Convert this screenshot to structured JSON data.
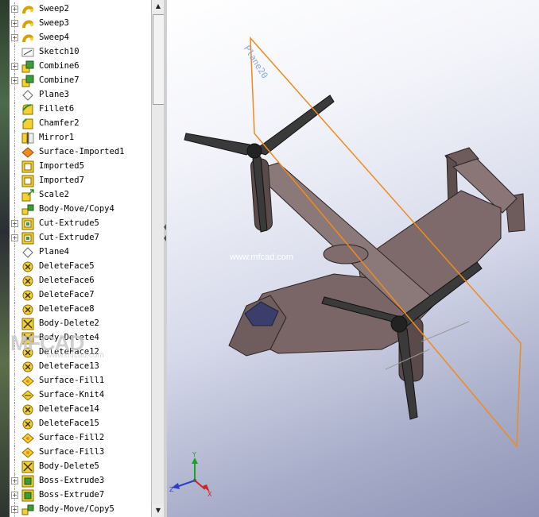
{
  "feature_tree": {
    "items": [
      {
        "label": "Sweep2",
        "icon": "sweep-icon",
        "expandable": true
      },
      {
        "label": "Sweep3",
        "icon": "sweep-icon",
        "expandable": true
      },
      {
        "label": "Sweep4",
        "icon": "sweep-icon",
        "expandable": true
      },
      {
        "label": "Sketch10",
        "icon": "sketch-icon",
        "expandable": false
      },
      {
        "label": "Combine6",
        "icon": "combine-icon",
        "expandable": true
      },
      {
        "label": "Combine7",
        "icon": "combine-icon",
        "expandable": true
      },
      {
        "label": "Plane3",
        "icon": "plane-icon",
        "expandable": false
      },
      {
        "label": "Fillet6",
        "icon": "fillet-icon",
        "expandable": false
      },
      {
        "label": "Chamfer2",
        "icon": "chamfer-icon",
        "expandable": false
      },
      {
        "label": "Mirror1",
        "icon": "mirror-icon",
        "expandable": false
      },
      {
        "label": "Surface-Imported1",
        "icon": "surface-imported-icon",
        "expandable": false
      },
      {
        "label": "Imported5",
        "icon": "imported-icon",
        "expandable": false
      },
      {
        "label": "Imported7",
        "icon": "imported-icon",
        "expandable": false
      },
      {
        "label": "Scale2",
        "icon": "scale-icon",
        "expandable": false
      },
      {
        "label": "Body-Move/Copy4",
        "icon": "move-copy-icon",
        "expandable": false
      },
      {
        "label": "Cut-Extrude5",
        "icon": "cut-extrude-icon",
        "expandable": true
      },
      {
        "label": "Cut-Extrude7",
        "icon": "cut-extrude-icon",
        "expandable": true
      },
      {
        "label": "Plane4",
        "icon": "plane-icon",
        "expandable": false
      },
      {
        "label": "DeleteFace5",
        "icon": "delete-face-icon",
        "expandable": false
      },
      {
        "label": "DeleteFace6",
        "icon": "delete-face-icon",
        "expandable": false
      },
      {
        "label": "DeleteFace7",
        "icon": "delete-face-icon",
        "expandable": false
      },
      {
        "label": "DeleteFace8",
        "icon": "delete-face-icon",
        "expandable": false
      },
      {
        "label": "Body-Delete2",
        "icon": "body-delete-icon",
        "expandable": false
      },
      {
        "label": "Body-Delete4",
        "icon": "body-delete-icon",
        "expandable": false
      },
      {
        "label": "DeleteFace12",
        "icon": "delete-face-icon",
        "expandable": false
      },
      {
        "label": "DeleteFace13",
        "icon": "delete-face-icon",
        "expandable": false
      },
      {
        "label": "Surface-Fill1",
        "icon": "surface-fill-icon",
        "expandable": false
      },
      {
        "label": "Surface-Knit4",
        "icon": "surface-knit-icon",
        "expandable": false
      },
      {
        "label": "DeleteFace14",
        "icon": "delete-face-icon",
        "expandable": false
      },
      {
        "label": "DeleteFace15",
        "icon": "delete-face-icon",
        "expandable": false
      },
      {
        "label": "Surface-Fill2",
        "icon": "surface-fill-icon",
        "expandable": false
      },
      {
        "label": "Surface-Fill3",
        "icon": "surface-fill-icon",
        "expandable": false
      },
      {
        "label": "Body-Delete5",
        "icon": "body-delete-icon",
        "expandable": false
      },
      {
        "label": "Boss-Extrude3",
        "icon": "boss-extrude-icon",
        "expandable": true
      },
      {
        "label": "Boss-Extrude7",
        "icon": "boss-extrude-icon",
        "expandable": true
      },
      {
        "label": "Body-Move/Copy5",
        "icon": "move-copy-icon",
        "expandable": true
      }
    ]
  },
  "scrollbar": {
    "up_arrow": "▲",
    "down_arrow": "▼"
  },
  "viewport": {
    "plane_label": "Plane20",
    "watermark_url": "www.mfcad.com",
    "watermark_logo": "MFCAD",
    "watermark_logo_url": "www.mfcad.com",
    "triad": {
      "x": "X",
      "y": "Y",
      "z": "Z"
    }
  },
  "colors": {
    "plane_edge": "#f08a1e",
    "fuselage": "#7e6a6a",
    "rotor": "#3a3a3a",
    "viewport_top": "#ffffff",
    "viewport_bottom": "#8f93b6"
  }
}
